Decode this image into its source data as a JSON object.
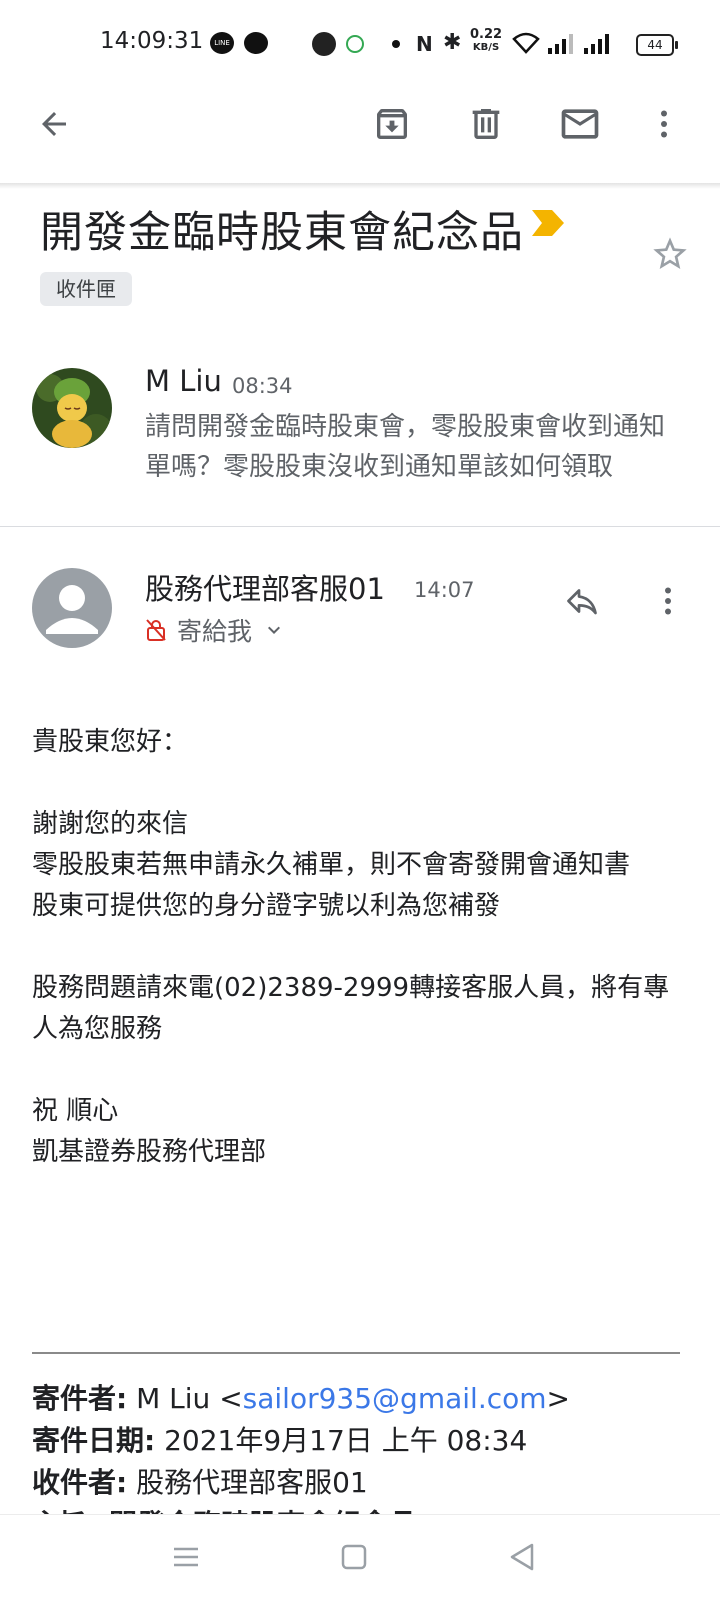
{
  "status_bar": {
    "time": "14:09:31",
    "speed_value": "0.22",
    "speed_unit": "KB/S",
    "battery": "44"
  },
  "toolbar": {
    "back": "arrow-back-icon",
    "archive": "archive-icon",
    "delete": "trash-icon",
    "mark_unread": "mail-icon",
    "more": "more-vert-icon"
  },
  "subject": {
    "title": "開發金臨時股東會紀念品",
    "label": "收件匣",
    "importance_color": "#f4b400"
  },
  "message1": {
    "sender": "M Liu",
    "time": "08:34",
    "snippet": "請問開發金臨時股東會，零股股東會收到通知單嗎？零股股東沒收到通知單該如何領取"
  },
  "message2": {
    "sender": "股務代理部客服01",
    "time": "14:07",
    "to": "寄給我",
    "body": {
      "greeting": "貴股東您好：",
      "line1": "謝謝您的來信",
      "line2": "零股股東若無申請永久補單，則不會寄發開會通知書",
      "line3": "股東可提供您的身分證字號以利為您補發",
      "line4": "股務問題請來電(02)2389-2999轉接客服人員，將有專人為您服務",
      "closing": "祝 順心",
      "signature": "凱基證券股務代理部"
    },
    "quoted": {
      "from_label": "寄件者:",
      "from_name": "M Liu <",
      "from_email": "sailor935@gmail.com",
      "from_end": ">",
      "date_label": "寄件日期:",
      "date_value": "2021年9月17日 上午 08:34",
      "to_label": "收件者:",
      "to_value": "股務代理部客服01",
      "subject_partial": "主旨: 開發金臨時股東會紀念品"
    }
  },
  "colors": {
    "link": "#3b78e7",
    "secondary_text": "#5f6368",
    "warning_lock": "#d93025"
  }
}
